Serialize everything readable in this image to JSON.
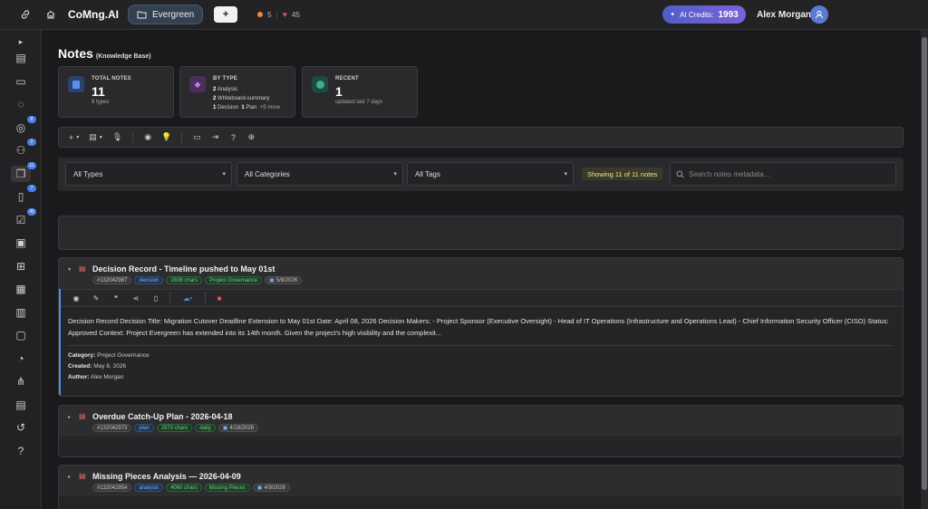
{
  "topbar": {
    "brand": "CoMng.AI",
    "project_name": "Evergreen",
    "plus_label": "+",
    "stat_orange": "5",
    "stat_hearts": "45",
    "credits_label": "AI Credits:",
    "credits_value": "1993",
    "user_name": "Alex Morgan"
  },
  "sidebar": {
    "expand_glyph": "▸",
    "items": [
      {
        "icon": "notes-edit-icon",
        "badge": ""
      },
      {
        "icon": "message-icon",
        "badge": ""
      },
      {
        "icon": "lightbulb-icon",
        "badge": ""
      },
      {
        "icon": "compass-icon",
        "badge": "8"
      },
      {
        "icon": "team-icon",
        "badge": "2"
      },
      {
        "icon": "copy-icon",
        "badge": "11",
        "active": true
      },
      {
        "icon": "document-icon",
        "badge": "7"
      },
      {
        "icon": "checklist-icon",
        "badge": "45"
      },
      {
        "icon": "briefcase-clock-icon",
        "badge": ""
      },
      {
        "icon": "hierarchy-icon",
        "badge": ""
      },
      {
        "icon": "calendar-icon",
        "badge": ""
      },
      {
        "icon": "kanban-icon",
        "badge": ""
      },
      {
        "icon": "report-icon",
        "badge": ""
      },
      {
        "icon": "head-gear-icon",
        "badge": ""
      },
      {
        "icon": "flow-icon",
        "badge": ""
      },
      {
        "icon": "form-icon",
        "badge": ""
      },
      {
        "icon": "history-icon",
        "badge": ""
      },
      {
        "icon": "help-icon",
        "badge": ""
      }
    ]
  },
  "page": {
    "title": "Notes",
    "subtitle": "(Knowledge Base)"
  },
  "cards": {
    "total": {
      "label": "TOTAL NOTES",
      "value": "11",
      "sub": "9 types"
    },
    "bytype": {
      "label": "BY TYPE",
      "line1_count": "2",
      "line1_text": "Analysis",
      "line2_count": "2",
      "line2_text": "Whiteboard-summary",
      "line3_count_a": "1",
      "line3_text_a": "Decision",
      "line3_count_b": "1",
      "line3_text_b": "Plan",
      "line3_more": "+5 more"
    },
    "recent": {
      "label": "RECENT",
      "value": "1",
      "sub": "updated last 7 days"
    }
  },
  "filters": {
    "types": "All Types",
    "categories": "All Categories",
    "tags": "All Tags",
    "showing": "Showing 11 of 11 notes",
    "search_placeholder": "Search notes metadata..."
  },
  "notes": [
    {
      "title": "Decision Record - Timeline pushed to May 01st",
      "id": "#132042987",
      "type": "decision",
      "chars": "2838 chars",
      "category_tag": "Project Governance",
      "date": "5/8/2026",
      "body": "Decision Record Decision Title: Migration Cutover Deadline Extension to May 01st Date: April 08, 2026 Decision Makers: - Project Sponsor (Executive Oversight) - Head of IT Operations (Infrastructure and Operations Lead) - Chief Information Security Officer (CISO) Status: Approved Context: Project Evergreen has extended into its 14th month. Given the project's high visibility and the complexit...",
      "category_label": "Category:",
      "category_value": "Project Governance",
      "created_label": "Created:",
      "created_value": "May 8, 2026",
      "author_label": "Author:",
      "author_value": "Alex Morgan"
    },
    {
      "title": "Overdue Catch-Up Plan - 2026-04-18",
      "id": "#132042973",
      "type": "plan",
      "chars": "2970 chars",
      "category_tag": "daily",
      "date": "4/18/2026"
    },
    {
      "title": "Missing Pieces Analysis — 2026-04-09",
      "id": "#132042954",
      "type": "analysis",
      "chars": "4060 chars",
      "category_tag": "Missing Pieces",
      "date": "4/9/2026"
    }
  ]
}
